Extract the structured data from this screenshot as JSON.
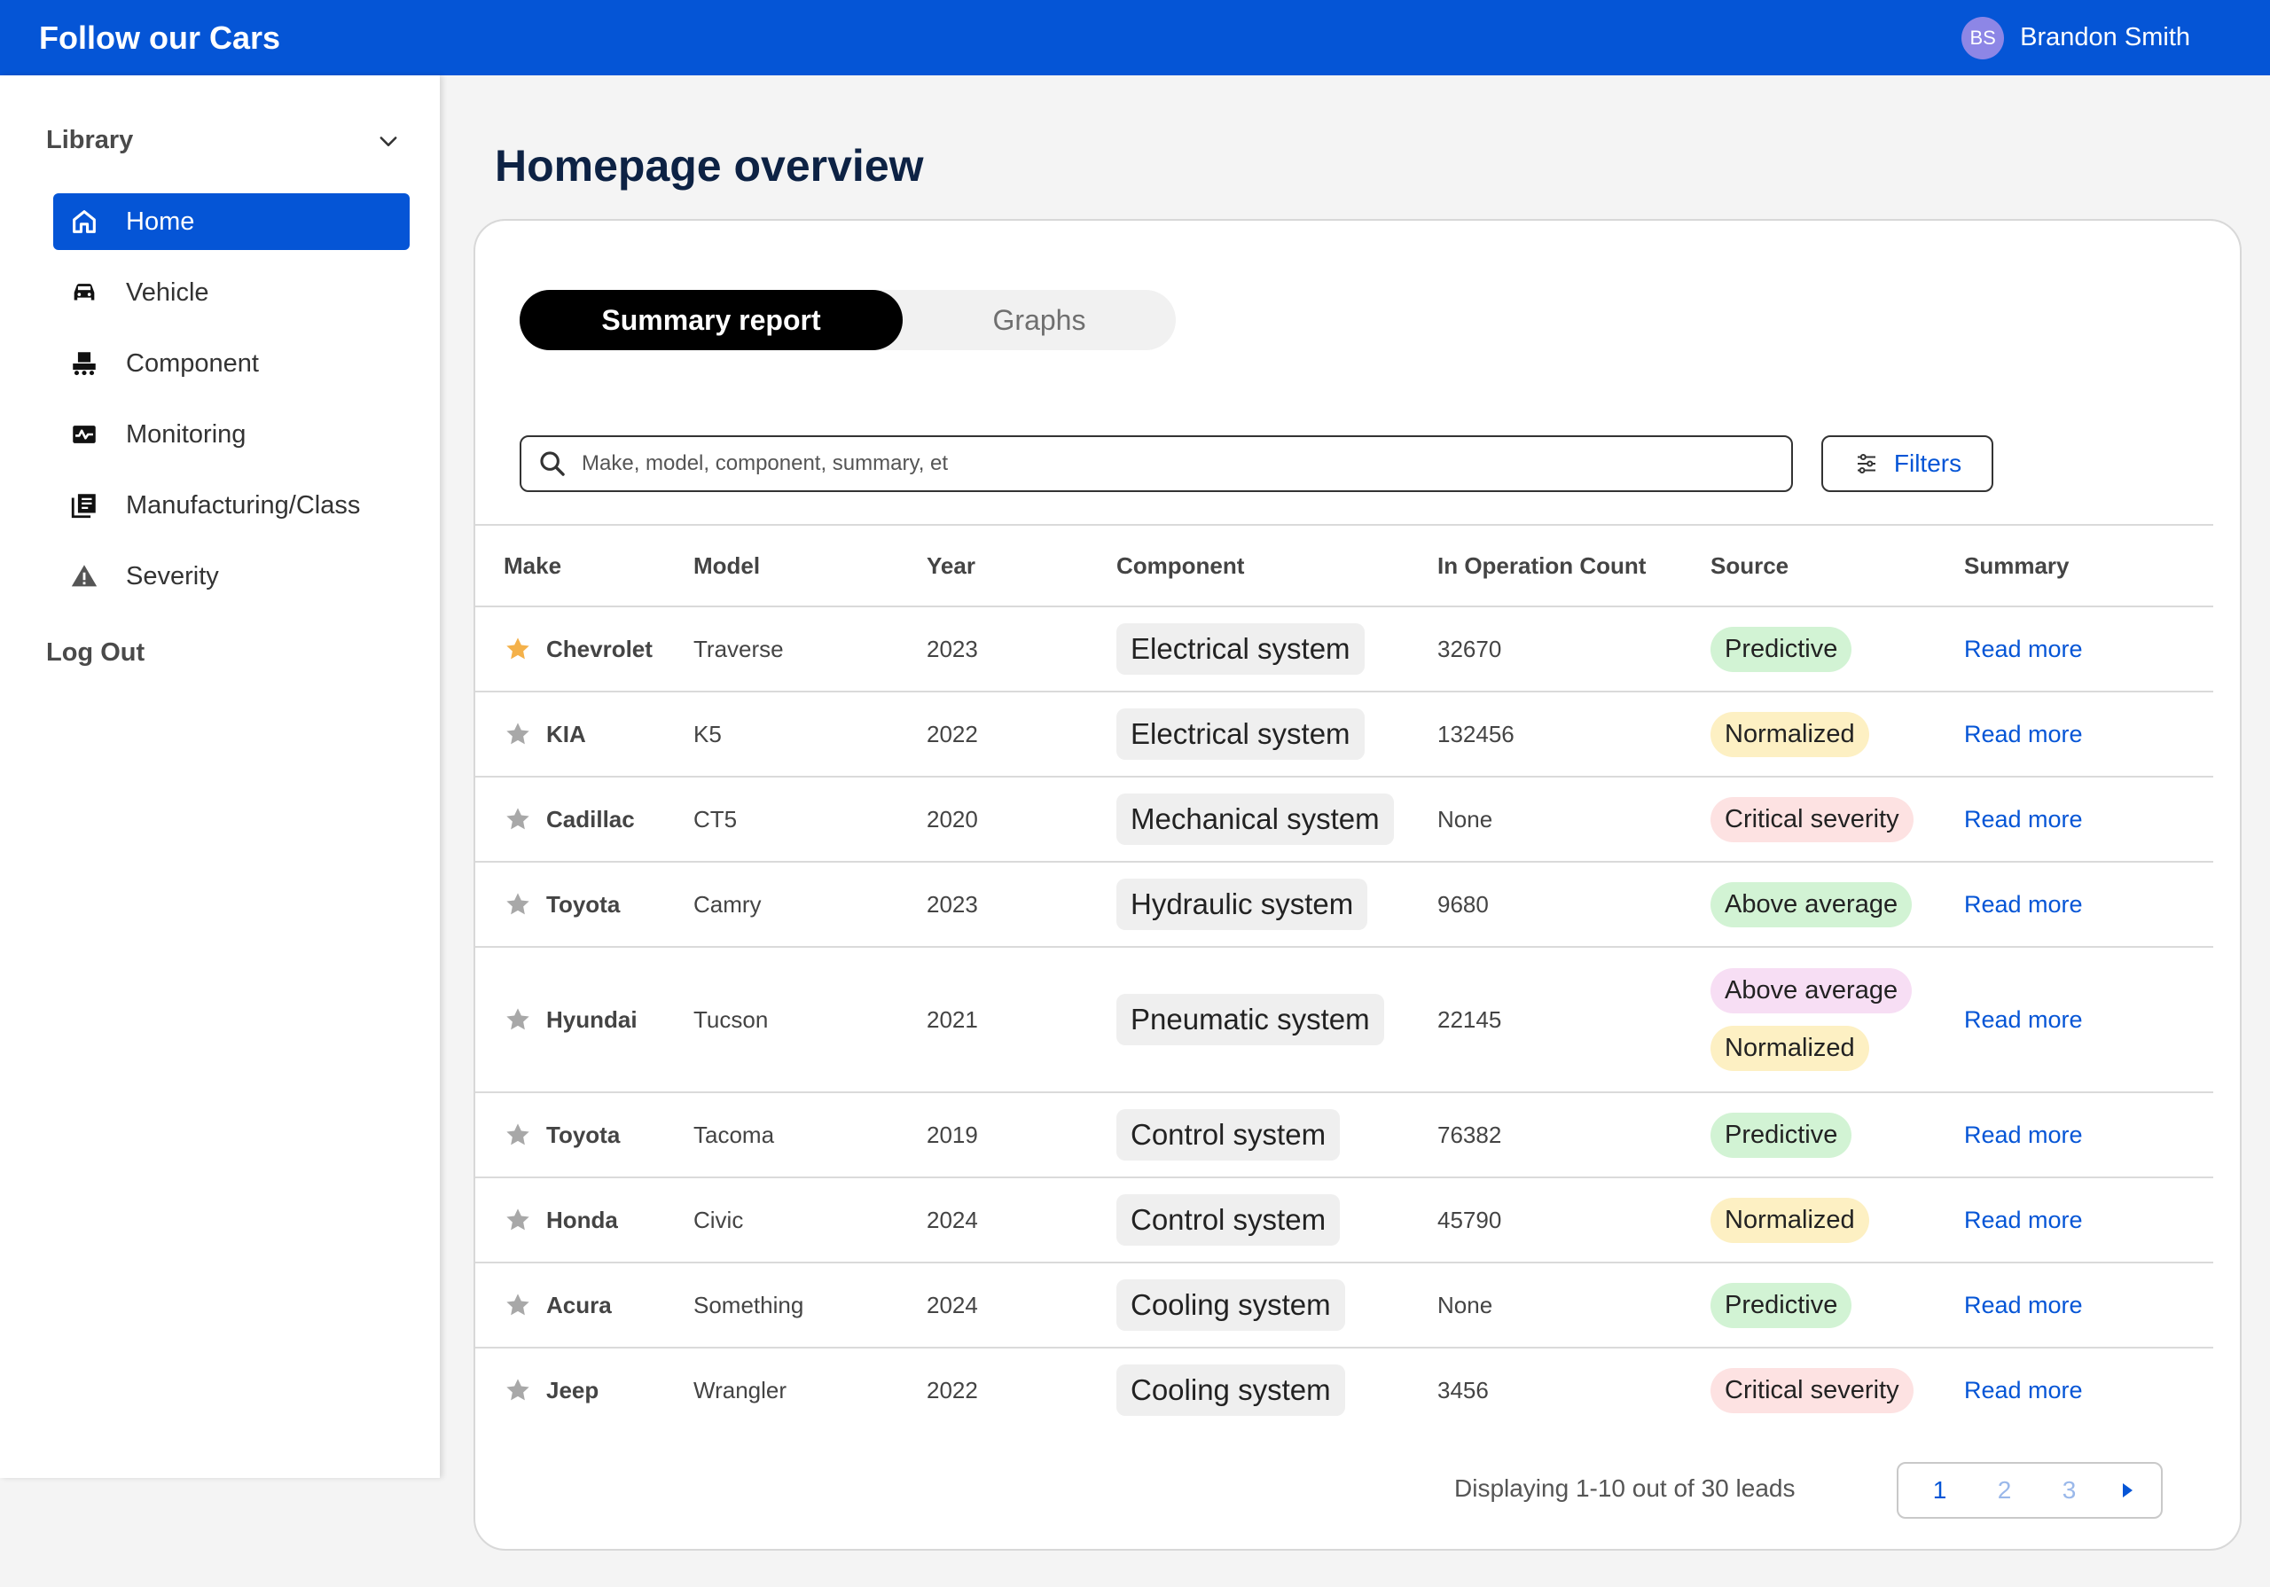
{
  "app": {
    "title": "Follow our Cars"
  },
  "user": {
    "initials": "BS",
    "name": "Brandon Smith"
  },
  "sidebar": {
    "section_label": "Library",
    "items": [
      {
        "label": "Home",
        "icon": "home-icon",
        "active": true
      },
      {
        "label": "Vehicle",
        "icon": "car-icon",
        "active": false
      },
      {
        "label": "Component",
        "icon": "component-icon",
        "active": false
      },
      {
        "label": "Monitoring",
        "icon": "monitoring-icon",
        "active": false
      },
      {
        "label": "Manufacturing/Class",
        "icon": "manufacturing-icon",
        "active": false
      },
      {
        "label": "Severity",
        "icon": "warning-icon",
        "active": false
      }
    ],
    "logout_label": "Log Out"
  },
  "main": {
    "page_title": "Homepage overview",
    "tabs": [
      {
        "label": "Summary report",
        "active": true
      },
      {
        "label": "Graphs",
        "active": false
      }
    ],
    "search": {
      "placeholder": "Make, model, component, summary, et",
      "value": ""
    },
    "filters_label": "Filters"
  },
  "table": {
    "columns": [
      "Make",
      "Model",
      "Year",
      "Component",
      "In Operation Count",
      "Source",
      "Summary"
    ],
    "rows": [
      {
        "make": "Chevrolet",
        "starred": true,
        "model": "Traverse",
        "year": "2023",
        "component": "Electrical system",
        "count": "32670",
        "sources": [
          "Predictive"
        ],
        "summary": "Read more"
      },
      {
        "make": "KIA",
        "starred": false,
        "model": "K5",
        "year": "2022",
        "component": "Electrical system",
        "count": "132456",
        "sources": [
          "Normalized"
        ],
        "summary": "Read more"
      },
      {
        "make": "Cadillac",
        "starred": false,
        "model": "CT5",
        "year": "2020",
        "component": "Mechanical system",
        "count": "None",
        "sources": [
          "Critical severity"
        ],
        "summary": "Read more"
      },
      {
        "make": "Toyota",
        "starred": false,
        "model": "Camry",
        "year": "2023",
        "component": "Hydraulic system",
        "count": "9680",
        "sources": [
          "Above average"
        ],
        "summary": "Read more"
      },
      {
        "make": "Hyundai",
        "starred": false,
        "model": "Tucson",
        "year": "2021",
        "component": "Pneumatic system",
        "count": "22145",
        "sources": [
          "Above average",
          "Normalized"
        ],
        "summary": "Read more"
      },
      {
        "make": "Toyota",
        "starred": false,
        "model": "Tacoma",
        "year": "2019",
        "component": "Control system",
        "count": "76382",
        "sources": [
          "Predictive"
        ],
        "summary": "Read more"
      },
      {
        "make": "Honda",
        "starred": false,
        "model": "Civic",
        "year": "2024",
        "component": "Control system",
        "count": "45790",
        "sources": [
          "Normalized"
        ],
        "summary": "Read more"
      },
      {
        "make": "Acura",
        "starred": false,
        "model": "Something",
        "year": "2024",
        "component": "Cooling system",
        "count": "None",
        "sources": [
          "Predictive"
        ],
        "summary": "Read more"
      },
      {
        "make": "Jeep",
        "starred": false,
        "model": "Wrangler",
        "year": "2022",
        "component": "Cooling system",
        "count": "3456",
        "sources": [
          "Critical severity"
        ],
        "summary": "Read more"
      }
    ]
  },
  "pagination": {
    "display_text": "Displaying 1-10 out of 30 leads",
    "pages": [
      "1",
      "2",
      "3"
    ],
    "current_page": "1"
  },
  "colors": {
    "brand_blue": "#0555d6",
    "predictive": "#d2f3d4",
    "normalized": "#fdf0c3",
    "critical": "#fde2e2",
    "above_average_alt": "#f7def4",
    "star_active": "#f4b14a",
    "star_inactive": "#a8a8a8"
  }
}
